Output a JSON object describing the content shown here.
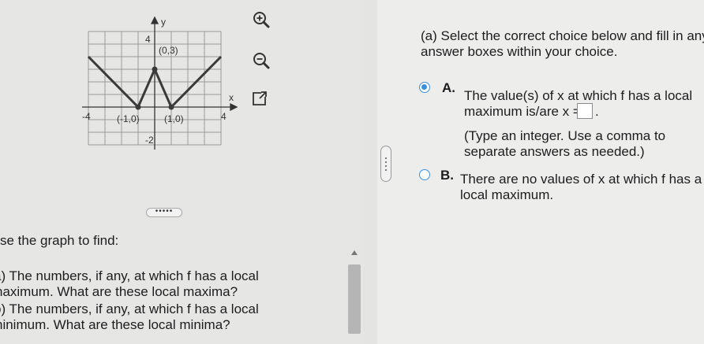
{
  "graph": {
    "y_axis_label": "y",
    "x_axis_label": "x",
    "tick_top": "4",
    "tick_left": "-4",
    "tick_right": "4",
    "tick_bottom": "-2",
    "point_max": "(0,3)",
    "point_min_left": "(-1,0)",
    "point_min_right": "(1,0)"
  },
  "graph_buttons": {
    "zoom_in": "zoom-in-icon",
    "zoom_out": "zoom-out-icon",
    "popout": "external-link-icon"
  },
  "ellipsis_label": "•••••",
  "instructions": {
    "line1": "se the graph to find:",
    "line2": "a) The numbers, if any, at which f has a local",
    "line3": "naximum. What are these local maxima?",
    "line4": "b) The numbers, if any, at which f has a local",
    "line5": "ninimum. What are these local minima?"
  },
  "question": {
    "prompt_line1": "(a) Select the correct choice below and fill in any",
    "prompt_line2": "answer boxes within your choice.",
    "option_a": {
      "letter": "A.",
      "line1": "The value(s) of x at which f has a local",
      "line2": "maximum is/are x =",
      "line2_end": ".",
      "hint1": "(Type an integer. Use a comma to",
      "hint2": "separate answers as needed.)",
      "answer_value": ""
    },
    "option_b": {
      "letter": "B.",
      "line1": "There are no values of x at which f has a",
      "line2": "local maximum."
    }
  },
  "colors": {
    "accent": "#3a8fd6",
    "graph_line": "#3a3a3a"
  }
}
